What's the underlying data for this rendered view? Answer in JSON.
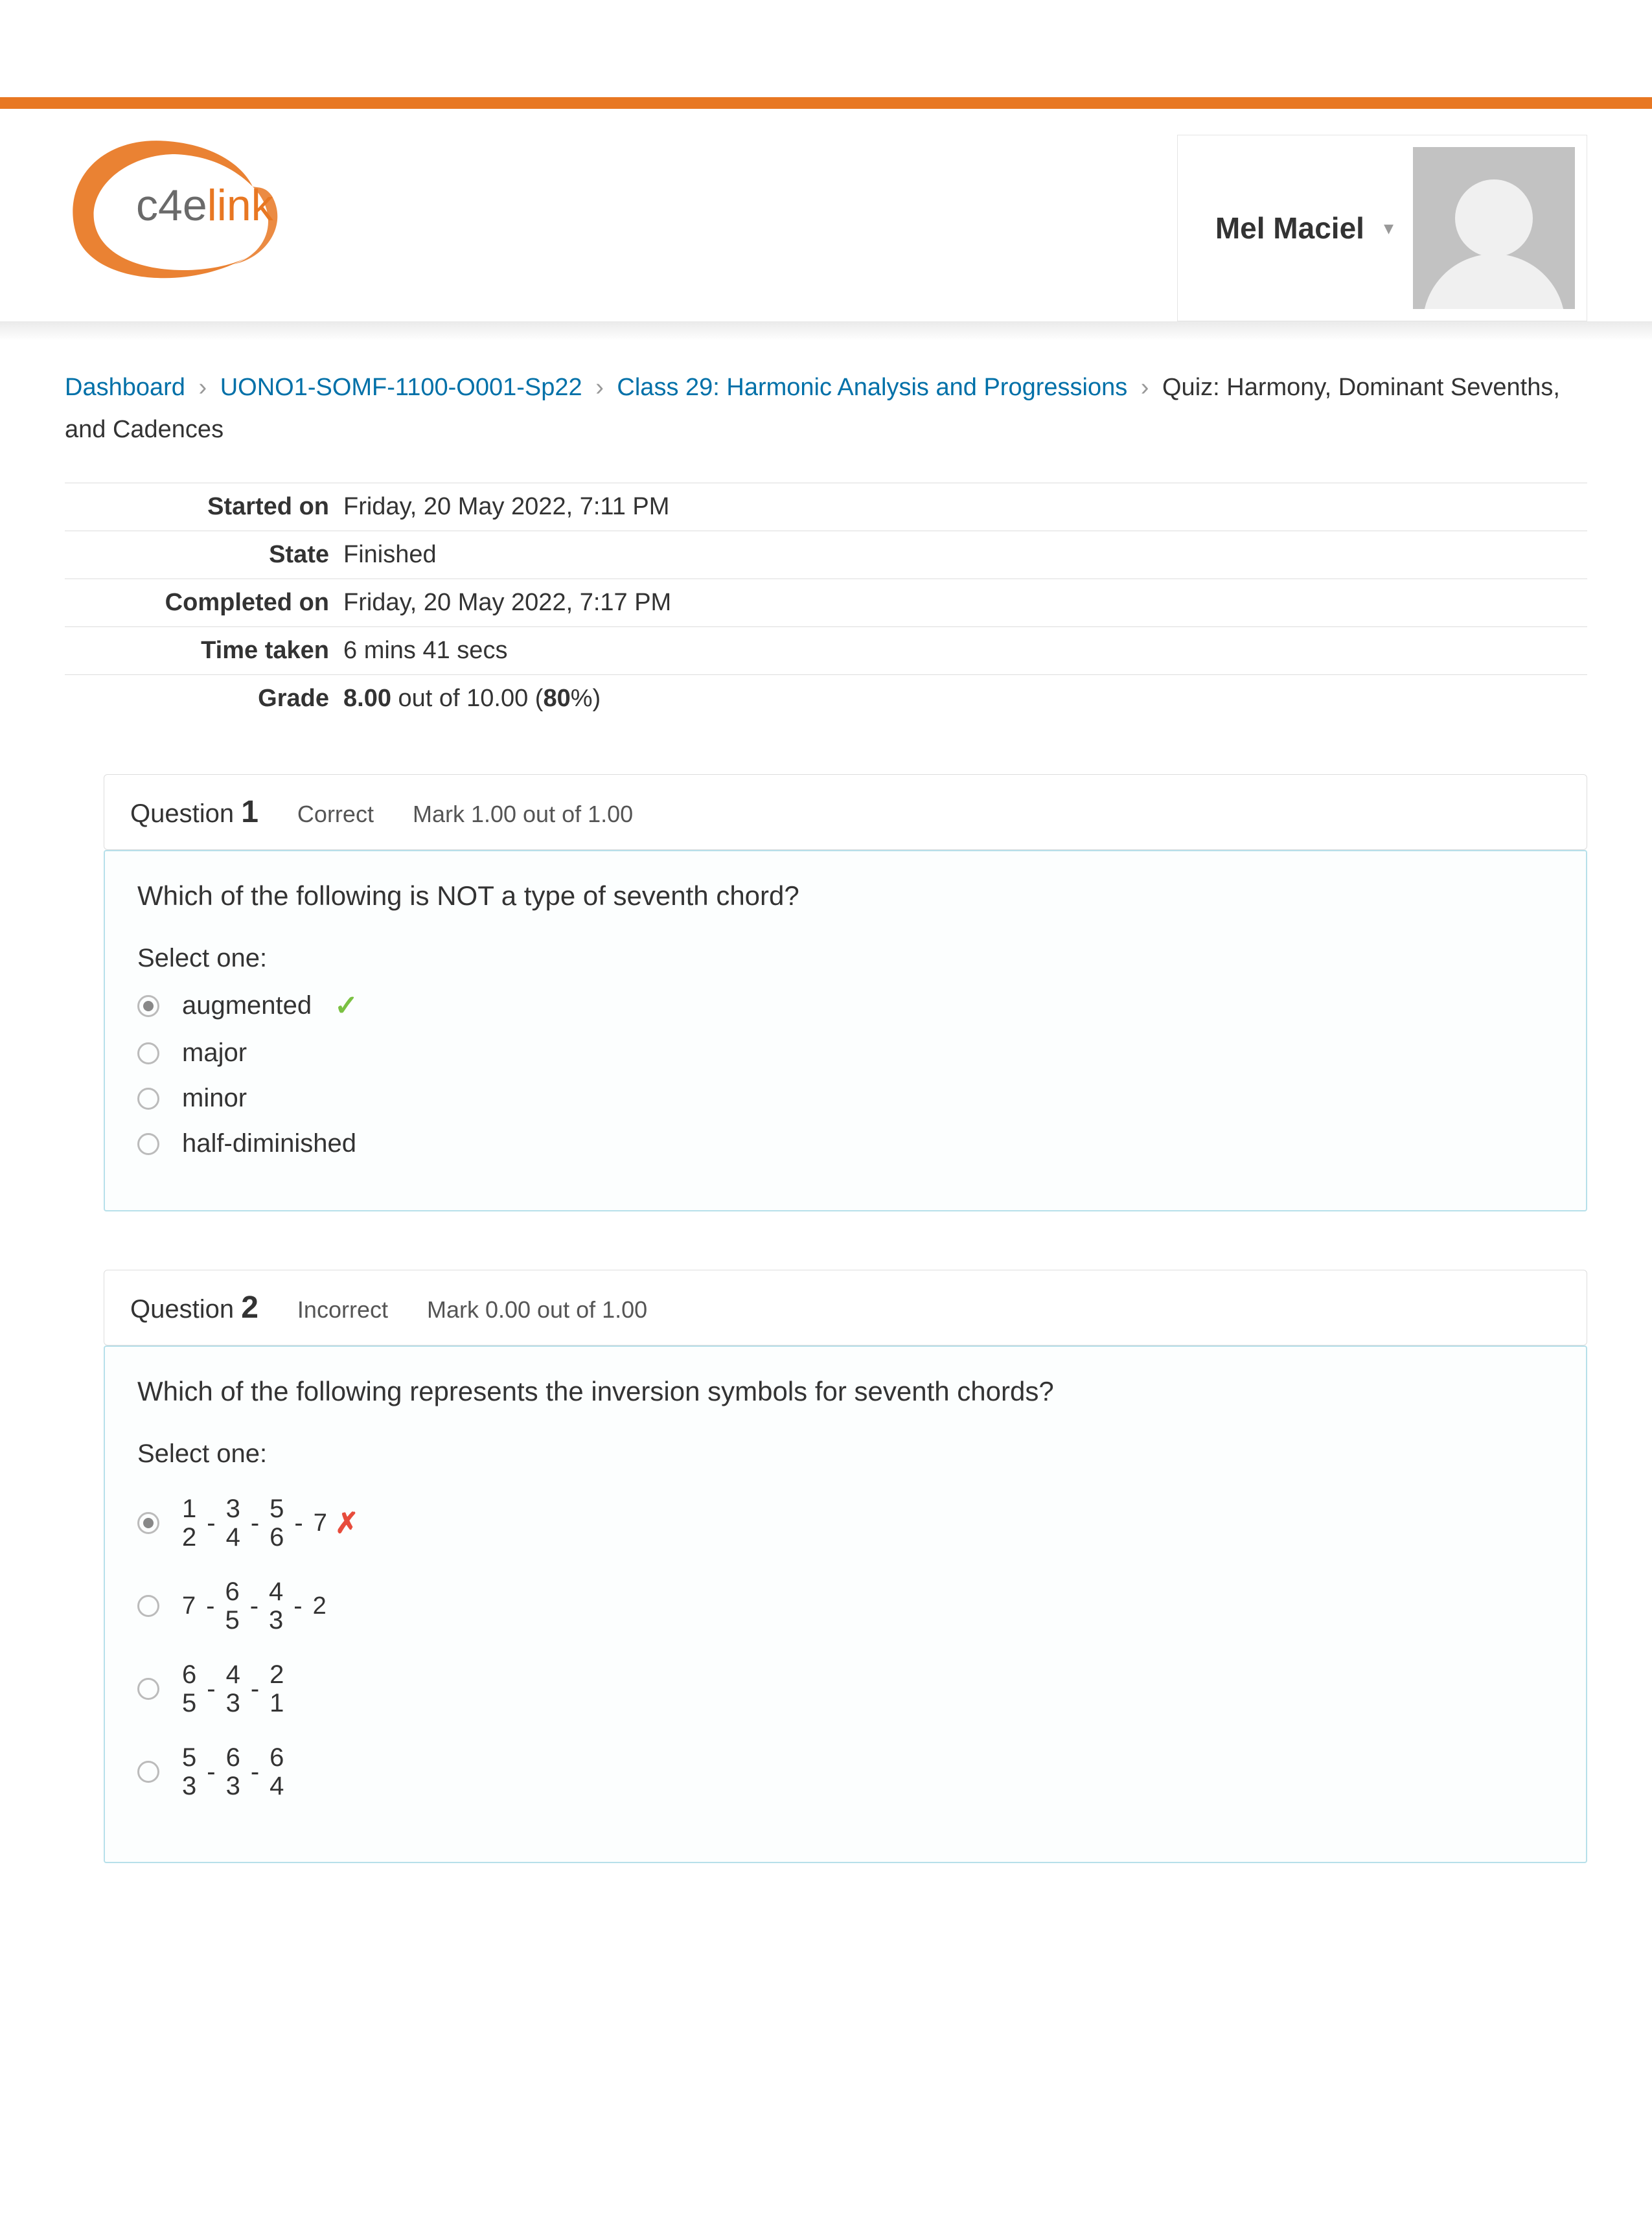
{
  "header": {
    "logo_prefix": "c4e",
    "logo_suffix": "link",
    "user_name": "Mel Maciel"
  },
  "breadcrumb": {
    "items": [
      "Dashboard",
      "UONO1-SOMF-1100-O001-Sp22",
      "Class 29: Harmonic Analysis and Progressions"
    ],
    "current": "Quiz: Harmony, Dominant Sevenths, and Cadences"
  },
  "summary": {
    "rows": [
      {
        "label": "Started on",
        "value": "Friday, 20 May 2022, 7:11 PM"
      },
      {
        "label": "State",
        "value": "Finished"
      },
      {
        "label": "Completed on",
        "value": "Friday, 20 May 2022, 7:17 PM"
      },
      {
        "label": "Time taken",
        "value": "6 mins 41 secs"
      }
    ],
    "grade_label": "Grade",
    "grade_score": "8.00",
    "grade_mid": " out of 10.00 (",
    "grade_pct": "80",
    "grade_end": "%)"
  },
  "q1": {
    "qlabel": "Question ",
    "qnum": "1",
    "status": "Correct",
    "mark": "Mark 1.00 out of 1.00",
    "prompt": "Which of the following is NOT a type of seventh chord?",
    "selectone": "Select one:",
    "opts": [
      "augmented",
      "major",
      "minor",
      "half-diminished"
    ]
  },
  "q2": {
    "qlabel": "Question ",
    "qnum": "2",
    "status": "Incorrect",
    "mark": "Mark 0.00 out of 1.00",
    "prompt": "Which of the following represents the inversion symbols for seventh chords?",
    "selectone": "Select one:",
    "inv": {
      "a": {
        "f1t": "1",
        "f1b": "2",
        "f2t": "3",
        "f2b": "4",
        "f3t": "5",
        "f3b": "6",
        "tail": "7"
      },
      "b": {
        "lead": "7",
        "f1t": "6",
        "f1b": "5",
        "f2t": "4",
        "f2b": "3",
        "tail": "2"
      },
      "c": {
        "f1t": "6",
        "f1b": "5",
        "f2t": "4",
        "f2b": "3",
        "f3t": "2",
        "f3b": "1"
      },
      "d": {
        "f1t": "5",
        "f1b": "3",
        "f2t": "6",
        "f2b": "3",
        "f3t": "6",
        "f3b": "4"
      }
    },
    "dash": "-"
  }
}
